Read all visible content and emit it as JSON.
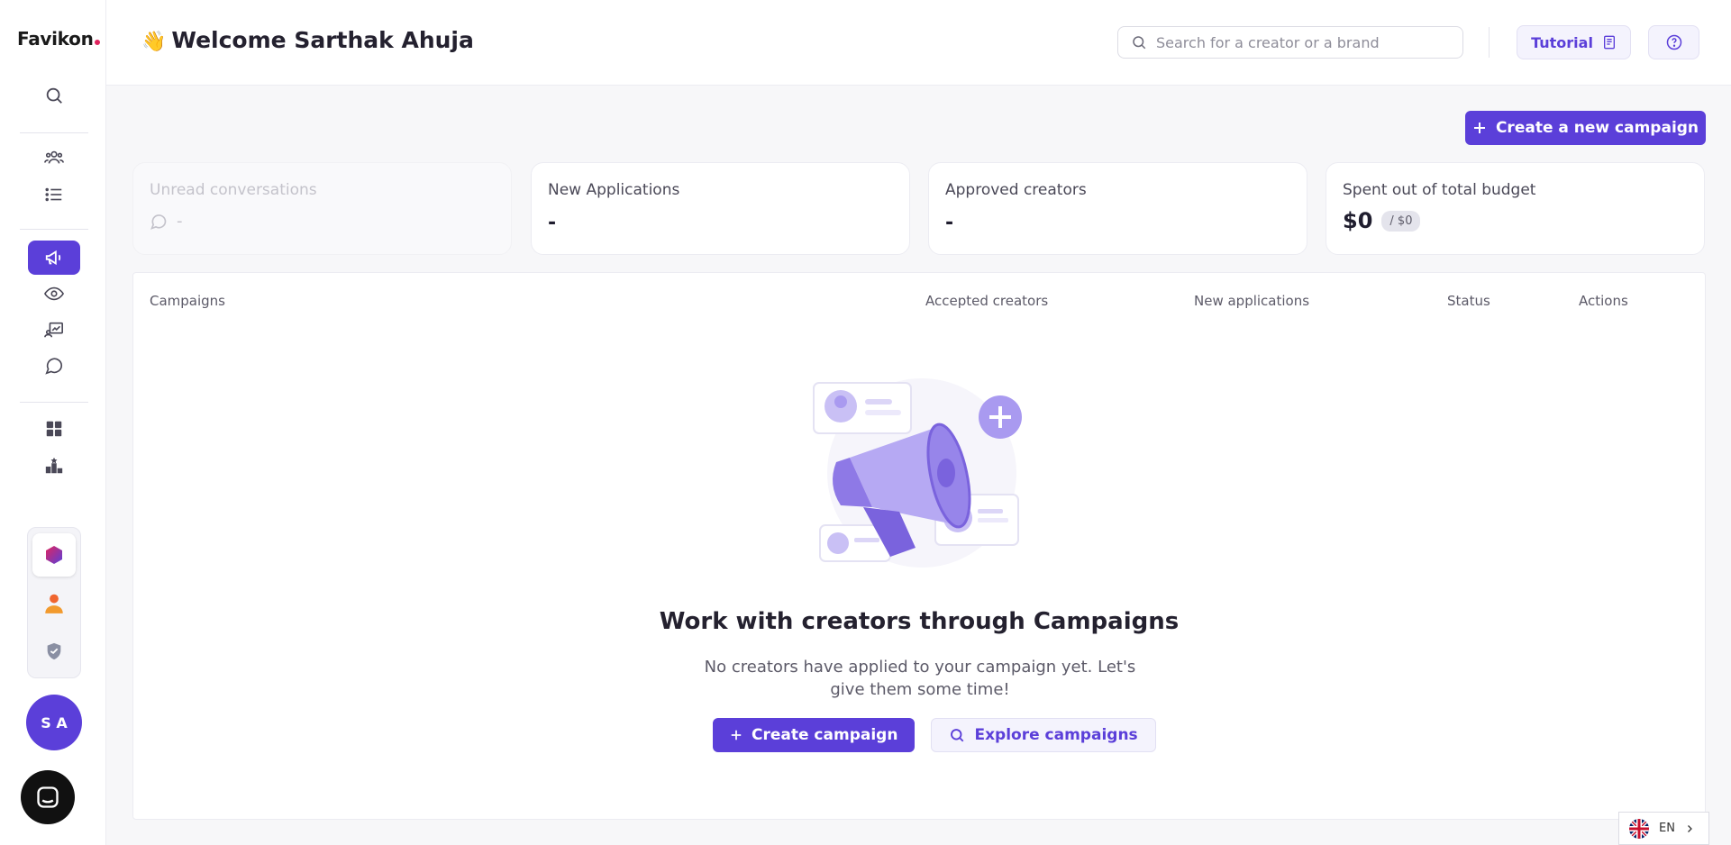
{
  "app": {
    "logo_text": "Favikon"
  },
  "header": {
    "wave_emoji": "👋",
    "welcome": "Welcome Sarthak Ahuja",
    "search_placeholder": "Search for a creator or a brand",
    "tutorial_label": "Tutorial"
  },
  "sidebar": {
    "icons": [
      "search-icon",
      "creators-icon",
      "lists-icon",
      "campaigns-icon",
      "monitoring-icon",
      "analytics-icon",
      "messages-icon",
      "dashboard-icon",
      "rankings-icon"
    ],
    "active": "campaigns-icon",
    "brands": [
      "brand-logo",
      "person-icon",
      "shield-icon"
    ],
    "avatar_initials": "S A"
  },
  "main": {
    "create_button": "Create a new campaign",
    "cards": [
      {
        "label": "Unread conversations",
        "value": "-"
      },
      {
        "label": "New Applications",
        "value": "-"
      },
      {
        "label": "Approved creators",
        "value": "-"
      },
      {
        "label": "Spent out of total budget",
        "value": "$0",
        "total": "/ $0"
      }
    ],
    "table": {
      "headers": [
        "Campaigns",
        "Accepted creators",
        "New applications",
        "Status",
        "Actions"
      ]
    },
    "empty": {
      "title": "Work with creators through Campaigns",
      "description": "No creators have applied to your campaign yet. Let's give them some time!",
      "primary_button": "Create campaign",
      "secondary_button": "Explore campaigns"
    }
  },
  "footer": {
    "language": "EN"
  },
  "colors": {
    "accent": "#5b3fd9",
    "illustration": "#a99af0"
  }
}
